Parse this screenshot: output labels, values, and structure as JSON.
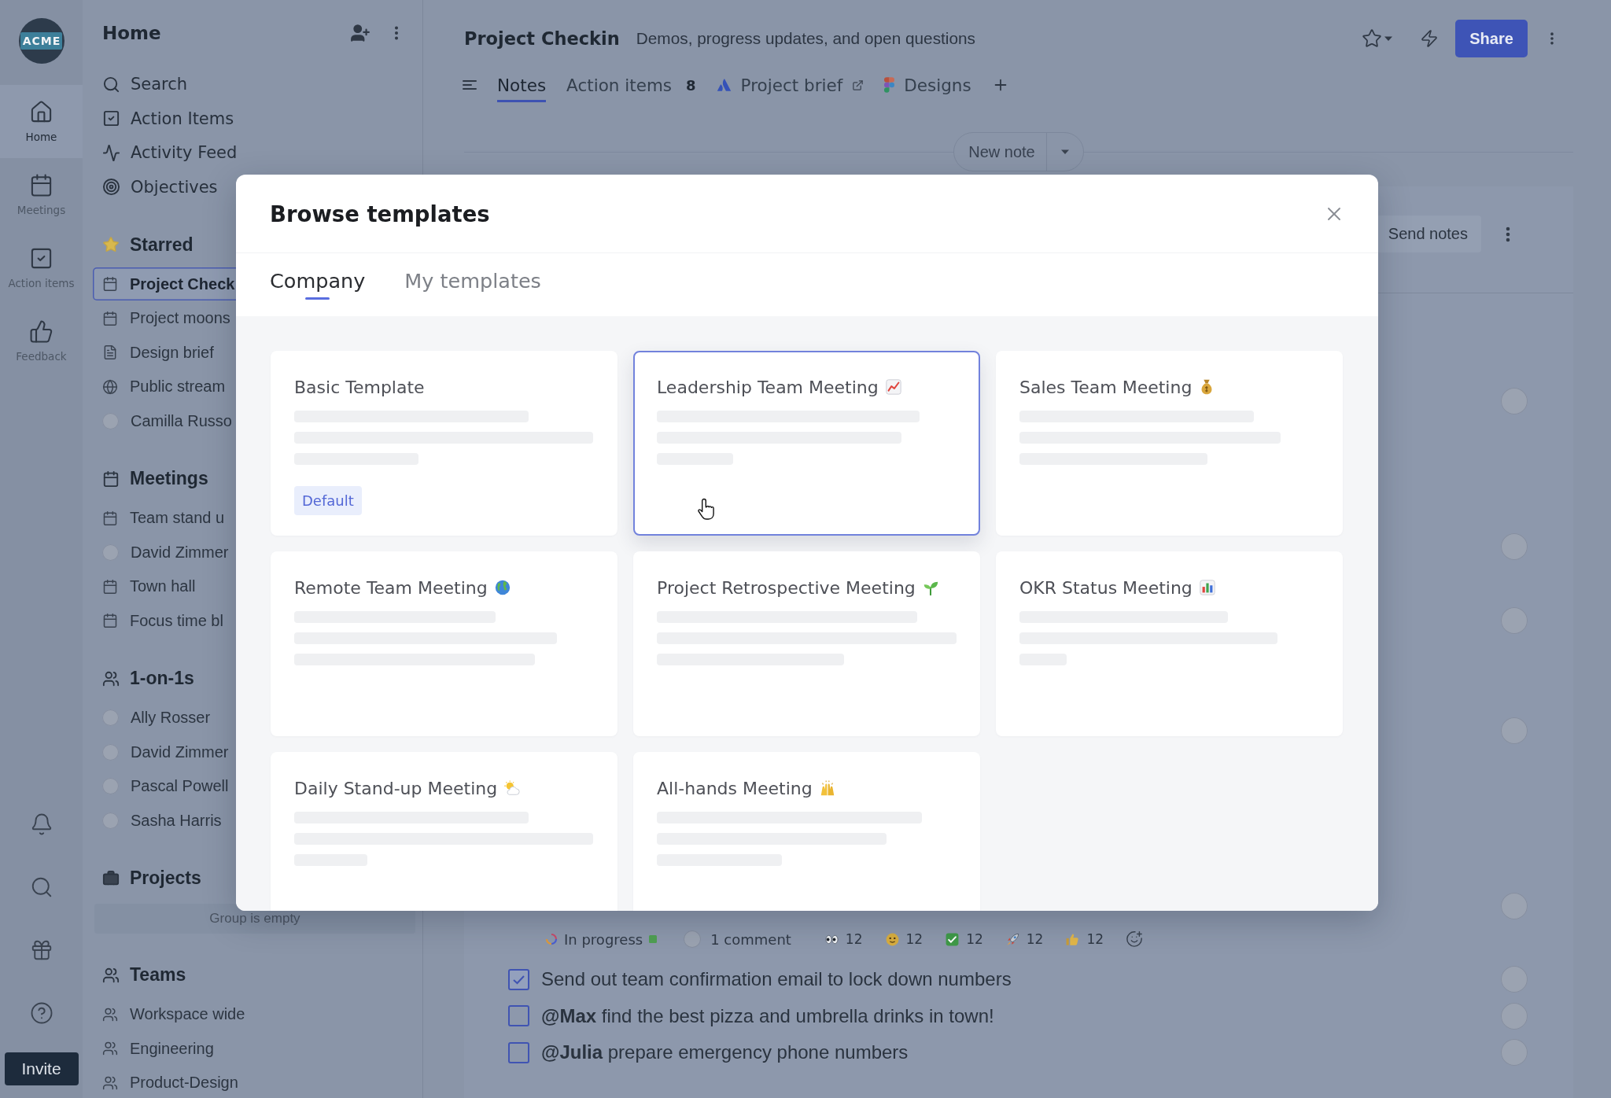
{
  "rail": {
    "logo": "ACME",
    "items": [
      {
        "kind": "home",
        "label": "Home",
        "selected": true
      },
      {
        "kind": "calendar",
        "label": "Meetings",
        "selected": false
      },
      {
        "kind": "check",
        "label": "Action items",
        "selected": false
      },
      {
        "kind": "thumb",
        "label": "Feedback",
        "selected": false
      }
    ],
    "invite_button": "Invite"
  },
  "sidebar": {
    "title": "Home",
    "nav": [
      {
        "kind": "search",
        "label": "Search"
      },
      {
        "kind": "check",
        "label": "Action Items"
      },
      {
        "kind": "activity",
        "label": "Activity Feed"
      },
      {
        "kind": "target",
        "label": "Objectives"
      }
    ],
    "sections": [
      {
        "kind": "star",
        "title": "Starred",
        "items": [
          {
            "kind": "meeting",
            "label": "Project Check",
            "selected": true
          },
          {
            "kind": "meeting",
            "label": "Project moons",
            "selected": false
          },
          {
            "kind": "doc",
            "label": "Design brief",
            "selected": false
          },
          {
            "kind": "stream",
            "label": "Public stream",
            "selected": false
          },
          {
            "kind": "person",
            "label": "Camilla Russo",
            "selected": false
          }
        ]
      },
      {
        "kind": "calendar",
        "title": "Meetings",
        "items": [
          {
            "kind": "meeting",
            "label": "Team stand u",
            "selected": false
          },
          {
            "kind": "person",
            "label": "David Zimmer",
            "selected": false
          },
          {
            "kind": "meeting",
            "label": "Town hall",
            "selected": false
          },
          {
            "kind": "meeting",
            "label": "Focus time bl",
            "selected": false
          }
        ]
      },
      {
        "kind": "people",
        "title": "1-on-1s",
        "items": [
          {
            "kind": "person",
            "label": "Ally Rosser",
            "selected": false
          },
          {
            "kind": "person",
            "label": "David Zimmer",
            "selected": false
          },
          {
            "kind": "person",
            "label": "Pascal Powell",
            "selected": false
          },
          {
            "kind": "person",
            "label": "Sasha Harris",
            "selected": false
          }
        ]
      },
      {
        "kind": "briefcase",
        "title": "Projects",
        "empty_note": "Group is empty"
      },
      {
        "kind": "team",
        "title": "Teams",
        "items": [
          {
            "kind": "team",
            "label": "Workspace wide",
            "selected": false
          },
          {
            "kind": "team",
            "label": "Engineering",
            "selected": false
          },
          {
            "kind": "team",
            "label": "Product-Design",
            "selected": false
          }
        ]
      }
    ]
  },
  "page": {
    "title": "Project Checkin",
    "subtitle": "Demos, progress updates, and open questions",
    "share_button": "Share",
    "tabs": [
      {
        "kind": "plain",
        "label": "Notes",
        "selected": true
      },
      {
        "kind": "plain",
        "label": "Action items",
        "count": "8",
        "selected": false
      },
      {
        "kind": "doc-link",
        "label": "Project brief",
        "selected": false
      },
      {
        "kind": "design",
        "label": "Designs",
        "selected": false
      }
    ],
    "new_note_button": "New note",
    "send_notes_button": "Send notes",
    "task_meta": {
      "status": "In progress",
      "comments": "1 comment",
      "reactions": [
        {
          "kind": "eyes",
          "count": "12"
        },
        {
          "kind": "face",
          "count": "12"
        },
        {
          "kind": "check",
          "count": "12"
        },
        {
          "kind": "rocket",
          "count": "12"
        },
        {
          "kind": "thumbs",
          "count": "12"
        }
      ]
    },
    "checklist": [
      {
        "text": "Send out team confirmation email to lock down numbers",
        "checked": true
      },
      {
        "text": "**@Max** find the best pizza and umbrella drinks in town!",
        "checked": false
      },
      {
        "text": "**@Julia** prepare emergency phone numbers",
        "checked": false
      }
    ]
  },
  "modal": {
    "title": "Browse templates",
    "tabs": [
      {
        "label": "Company",
        "selected": true
      },
      {
        "label": "My templates",
        "selected": false
      }
    ],
    "templates": [
      {
        "kind": "plain",
        "title": "Basic Template",
        "badge": "Default",
        "selected": false
      },
      {
        "kind": "chart",
        "title": "Leadership Team Meeting",
        "selected": true
      },
      {
        "kind": "money",
        "title": "Sales Team Meeting",
        "selected": false
      },
      {
        "kind": "globe",
        "title": "Remote Team Meeting",
        "selected": false
      },
      {
        "kind": "seedling",
        "title": "Project Retrospective Meeting",
        "selected": false
      },
      {
        "kind": "barchart",
        "title": "OKR Status Meeting",
        "selected": false
      },
      {
        "kind": "sun-cloud",
        "title": "Daily Stand-up Meeting",
        "selected": false
      },
      {
        "kind": "hands",
        "title": "All-hands Meeting",
        "selected": false
      }
    ]
  }
}
